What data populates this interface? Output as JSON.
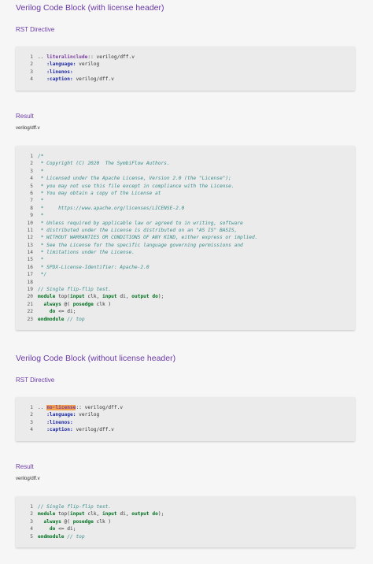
{
  "section1": {
    "title": "Verilog Code Block (with license header)",
    "rst_heading": "RST Directive",
    "rst_lines": [
      {
        "n": "1",
        "parts": [
          [
            "plain",
            ".. "
          ],
          [
            "dir",
            "literalinclude"
          ],
          [
            "plain",
            ":: verilog/dff.v"
          ]
        ]
      },
      {
        "n": "2",
        "parts": [
          [
            "plain",
            "   "
          ],
          [
            "opt",
            ":language:"
          ],
          [
            "plain",
            " verilog"
          ]
        ]
      },
      {
        "n": "3",
        "parts": [
          [
            "plain",
            "   "
          ],
          [
            "opt",
            ":linenos:"
          ]
        ]
      },
      {
        "n": "4",
        "parts": [
          [
            "plain",
            "   "
          ],
          [
            "opt",
            ":caption:"
          ],
          [
            "plain",
            " verilog/dff.v"
          ]
        ]
      }
    ],
    "result_heading": "Result",
    "result_caption": "verilog/dff.v",
    "result_lines": [
      {
        "n": "1",
        "parts": [
          [
            "cm",
            "/*"
          ]
        ]
      },
      {
        "n": "2",
        "parts": [
          [
            "cm",
            " * Copyright (C) 2020  The SymbiFlow Authors."
          ]
        ]
      },
      {
        "n": "3",
        "parts": [
          [
            "cm",
            " *"
          ]
        ]
      },
      {
        "n": "4",
        "parts": [
          [
            "cm",
            " * Licensed under the Apache License, Version 2.0 (the \"License\");"
          ]
        ]
      },
      {
        "n": "5",
        "parts": [
          [
            "cm",
            " * you may not use this file except in compliance with the License."
          ]
        ]
      },
      {
        "n": "6",
        "parts": [
          [
            "cm",
            " * You may obtain a copy of the License at"
          ]
        ]
      },
      {
        "n": "7",
        "parts": [
          [
            "cm",
            " *"
          ]
        ]
      },
      {
        "n": "8",
        "parts": [
          [
            "cm",
            " *     https://www.apache.org/licenses/LICENSE-2.0"
          ]
        ]
      },
      {
        "n": "9",
        "parts": [
          [
            "cm",
            " *"
          ]
        ]
      },
      {
        "n": "10",
        "parts": [
          [
            "cm",
            " * Unless required by applicable law or agreed to in writing, software"
          ]
        ]
      },
      {
        "n": "11",
        "parts": [
          [
            "cm",
            " * distributed under the License is distributed on an \"AS IS\" BASIS,"
          ]
        ]
      },
      {
        "n": "12",
        "parts": [
          [
            "cm",
            " * WITHOUT WARRANTIES OR CONDITIONS OF ANY KIND, either express or implied."
          ]
        ]
      },
      {
        "n": "13",
        "parts": [
          [
            "cm",
            " * See the License for the specific language governing permissions and"
          ]
        ]
      },
      {
        "n": "14",
        "parts": [
          [
            "cm",
            " * limitations under the License."
          ]
        ]
      },
      {
        "n": "15",
        "parts": [
          [
            "cm",
            " *"
          ]
        ]
      },
      {
        "n": "16",
        "parts": [
          [
            "cm",
            " * SPDX-License-Identifier: Apache-2.0"
          ]
        ]
      },
      {
        "n": "17",
        "parts": [
          [
            "cm",
            " */"
          ]
        ]
      },
      {
        "n": "18",
        "parts": [
          [
            "plain",
            ""
          ]
        ]
      },
      {
        "n": "19",
        "parts": [
          [
            "cm",
            "// Single flip-flip test."
          ]
        ]
      },
      {
        "n": "20",
        "parts": [
          [
            "kw",
            "module"
          ],
          [
            "plain",
            " top("
          ],
          [
            "kw",
            "input"
          ],
          [
            "plain",
            " clk, "
          ],
          [
            "kw",
            "input"
          ],
          [
            "plain",
            " di, "
          ],
          [
            "kw",
            "output"
          ],
          [
            "plain",
            " "
          ],
          [
            "kw",
            "do"
          ],
          [
            "plain",
            ");"
          ]
        ]
      },
      {
        "n": "21",
        "parts": [
          [
            "plain",
            "  "
          ],
          [
            "kw",
            "always"
          ],
          [
            "plain",
            " @( "
          ],
          [
            "kw",
            "posedge"
          ],
          [
            "plain",
            " clk )"
          ]
        ]
      },
      {
        "n": "22",
        "parts": [
          [
            "plain",
            "    "
          ],
          [
            "kw",
            "do"
          ],
          [
            "plain",
            " <= di;"
          ]
        ]
      },
      {
        "n": "23",
        "parts": [
          [
            "kw",
            "endmodule"
          ],
          [
            "plain",
            " "
          ],
          [
            "cm",
            "// top"
          ]
        ]
      }
    ]
  },
  "section2": {
    "title": "Verilog Code Block (without license header)",
    "rst_heading": "RST Directive",
    "rst_lines": [
      {
        "n": "1",
        "parts": [
          [
            "plain",
            ".. "
          ],
          [
            "hl",
            "no-license"
          ],
          [
            "plain",
            ":: verilog/dff.v"
          ]
        ]
      },
      {
        "n": "2",
        "parts": [
          [
            "plain",
            "   "
          ],
          [
            "opt",
            ":language:"
          ],
          [
            "plain",
            " verilog"
          ]
        ]
      },
      {
        "n": "3",
        "parts": [
          [
            "plain",
            "   "
          ],
          [
            "opt",
            ":linenos:"
          ]
        ]
      },
      {
        "n": "4",
        "parts": [
          [
            "plain",
            "   "
          ],
          [
            "opt",
            ":caption:"
          ],
          [
            "plain",
            " verilog/dff.v"
          ]
        ]
      }
    ],
    "result_heading": "Result",
    "result_caption": "verilog/dff.v",
    "result_lines": [
      {
        "n": "1",
        "parts": [
          [
            "cm",
            "// Single flip-flip test."
          ]
        ]
      },
      {
        "n": "2",
        "parts": [
          [
            "kw",
            "module"
          ],
          [
            "plain",
            " top("
          ],
          [
            "kw",
            "input"
          ],
          [
            "plain",
            " clk, "
          ],
          [
            "kw",
            "input"
          ],
          [
            "plain",
            " di, "
          ],
          [
            "kw",
            "output"
          ],
          [
            "plain",
            " "
          ],
          [
            "kw",
            "do"
          ],
          [
            "plain",
            ");"
          ]
        ]
      },
      {
        "n": "3",
        "parts": [
          [
            "plain",
            "  "
          ],
          [
            "kw",
            "always"
          ],
          [
            "plain",
            " @( "
          ],
          [
            "kw",
            "posedge"
          ],
          [
            "plain",
            " clk )"
          ]
        ]
      },
      {
        "n": "4",
        "parts": [
          [
            "plain",
            "    "
          ],
          [
            "kw",
            "do"
          ],
          [
            "plain",
            " <= di;"
          ]
        ]
      },
      {
        "n": "5",
        "parts": [
          [
            "kw",
            "endmodule"
          ],
          [
            "plain",
            " "
          ],
          [
            "cm",
            "// top"
          ]
        ]
      }
    ]
  }
}
